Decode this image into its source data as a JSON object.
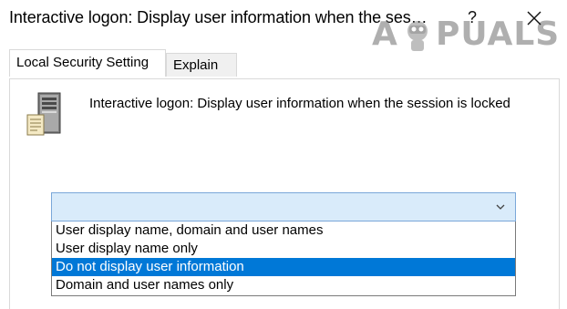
{
  "window": {
    "title": "Interactive logon: Display user information when the session is locked Properties",
    "help_glyph": "?",
    "close_icon": "close-icon"
  },
  "watermark": {
    "text_a": "A",
    "text_rest": "PUALS"
  },
  "tabs": [
    {
      "label": "Local Security Setting",
      "active": true
    },
    {
      "label": "Explain",
      "active": false
    }
  ],
  "policy": {
    "icon": "server-policy-icon",
    "name": "Interactive logon: Display user information when the session is locked"
  },
  "dropdown": {
    "selected_value": "",
    "options": [
      "User display name, domain and user names",
      "User display name only",
      "Do not display user information",
      "Domain and user names only"
    ],
    "highlighted_index": 2
  },
  "colors": {
    "selection": "#0078d7",
    "combo_focus_bg": "#d9ebfa",
    "combo_focus_border": "#7aa7d9"
  }
}
